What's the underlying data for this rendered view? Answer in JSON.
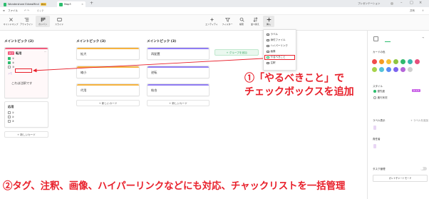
{
  "titlebar": {
    "app_name": "Wondershare EdrawMind",
    "pro_badge": "PRO",
    "doc_tab": "Map3",
    "new_tab": "+",
    "user_label": "プレゼンテーション",
    "colors": {
      "bg": "#e9ebee"
    }
  },
  "menubar": {
    "file_label": "ファイル",
    "share_label": "共有",
    "export_icon": "export-icon"
  },
  "toolbar": {
    "left_buttons": [
      {
        "label": "マインドマップ",
        "icon": "mindmap-icon"
      },
      {
        "label": "アウトライン",
        "icon": "outline-icon"
      },
      {
        "label": "カンバン",
        "icon": "kanban-icon"
      },
      {
        "label": "スライド",
        "icon": "slide-icon"
      }
    ],
    "right_buttons": [
      {
        "label": "エンティティ",
        "icon": "entity-icon"
      },
      {
        "label": "フィルター",
        "icon": "filter-icon"
      },
      {
        "label": "検索",
        "icon": "search-icon"
      },
      {
        "label": "並べ替え",
        "icon": "sort-icon"
      },
      {
        "label": "挿入",
        "icon": "insert-icon"
      }
    ]
  },
  "board": {
    "columns": [
      {
        "title": "メイントピック (2)",
        "cards": [
          {
            "title": "転用",
            "tag": "タグ",
            "todos": [
              "①",
              "②",
              "③"
            ],
            "note_hint": "メモ",
            "note_text": "これは注釈です",
            "accent": "#f15b7c"
          },
          {
            "title": "応用",
            "todos": [
              "①",
              "②",
              "③"
            ],
            "accent": "#9aa0a6"
          }
        ],
        "new_card": "+ 新しいカード"
      },
      {
        "title": "メイントピック (3)",
        "cards": [
          {
            "title": "拡大",
            "accent": "#f6b33f"
          },
          {
            "title": "縮小",
            "accent": "#f6b33f"
          },
          {
            "title": "代用",
            "accent": "#f6b33f"
          }
        ],
        "new_card": "+ 新しいカード"
      },
      {
        "title": "メイントピック (3)",
        "cards": [
          {
            "title": "再配置",
            "accent": "#8f7cf3"
          },
          {
            "title": "逆転",
            "accent": "#8f7cf3"
          },
          {
            "title": "結合",
            "accent": "#8f7cf3"
          }
        ],
        "new_card": "+ 新しいカード"
      }
    ],
    "add_group": "+ グループを追加"
  },
  "insert_menu": {
    "items": [
      {
        "label": "ラベル",
        "icon": "label-icon"
      },
      {
        "label": "添付ファイル",
        "icon": "attachment-icon"
      },
      {
        "label": "ハイパーリンク",
        "icon": "hyperlink-icon"
      },
      {
        "label": "画像",
        "icon": "image-icon"
      },
      {
        "label": "やるべきこと",
        "icon": "todo-icon",
        "highlighted": true
      },
      {
        "label": "注釈",
        "icon": "note-icon"
      }
    ]
  },
  "right_panel": {
    "card_color_label": "カードの色",
    "colors_row1": [
      "#f04b4b",
      "#f59b23",
      "#f6c233",
      "#8fc641",
      "#31b96d",
      "#3ab5b0",
      "#e74f7c"
    ],
    "colors_row2": [
      "#a7d34a",
      "#54c3d8",
      "#5b8cf5",
      "#7d63ef",
      "#b464d8",
      "#d0d0d0"
    ],
    "style_label": "スタイル",
    "option1": "優先度",
    "option1_tag": "タスク",
    "option2": "進行状況",
    "label_section": "ラベル表示",
    "add_label": "+ ラベルを追加",
    "assignee_label": "責任者",
    "task_label": "タスク管理",
    "mode_button": "ガントチャートモード"
  },
  "annotations": {
    "line1": "①「やるべきこと」で",
    "line2": "チェックボックスを追加",
    "bottom": "②タグ、注釈、画像、ハイパーリンクなどにも対応、チャックリストを一括管理"
  }
}
